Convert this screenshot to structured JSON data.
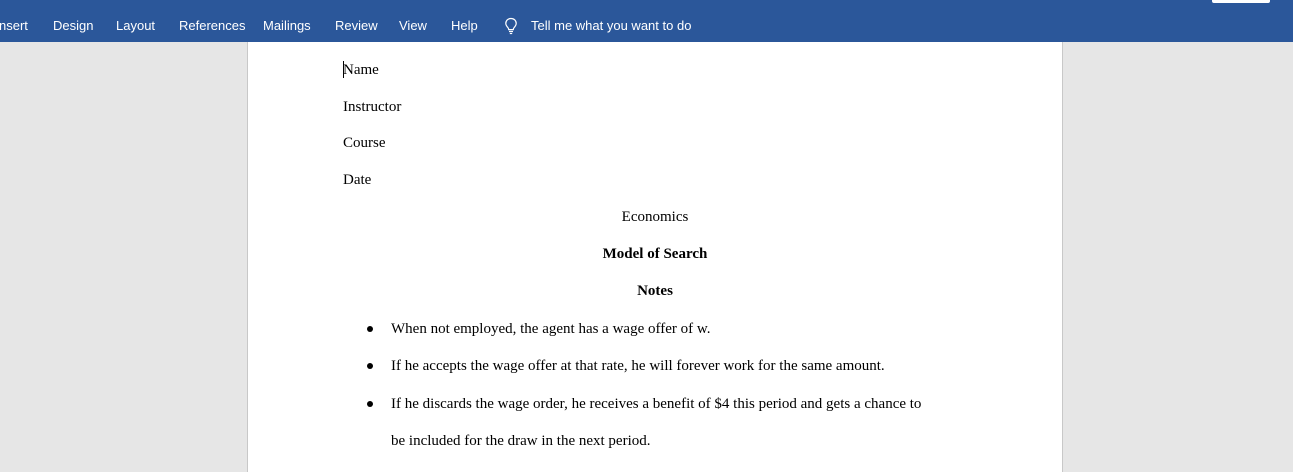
{
  "ribbon": {
    "tabs": [
      "nsert",
      "Design",
      "Layout",
      "References",
      "Mailings",
      "Review",
      "View",
      "Help"
    ],
    "tell_me": "Tell me what you want to do",
    "tell_me_icon": "lightbulb-icon",
    "background_color": "#2b579a"
  },
  "document": {
    "header_lines": [
      "Name",
      "Instructor",
      "Course",
      "Date"
    ],
    "subject": "Economics",
    "title": "Model of Search",
    "subtitle": "Notes",
    "bullets": [
      "When not employed, the agent has a wage offer of w.",
      "If he accepts the wage offer at that rate, he will forever work for the same amount.",
      "If he discards the wage order, he receives a benefit of $4 this period and gets a chance to"
    ],
    "bullet_continuation": "be included for the draw in the next period."
  }
}
